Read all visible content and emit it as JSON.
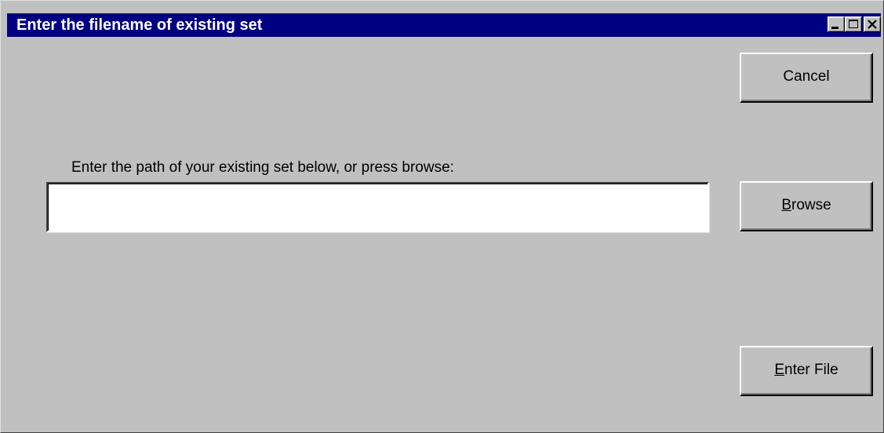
{
  "window": {
    "title": "Enter the filename of existing set",
    "controls": {
      "minimize_icon": "minimize-icon",
      "maximize_icon": "maximize-icon",
      "close_icon": "close-icon"
    },
    "title_bar_color": "#000080",
    "face_color": "#c0c0c0"
  },
  "form": {
    "prompt": "Enter the path of your existing set below, or press browse:",
    "path_value": "",
    "path_placeholder": ""
  },
  "buttons": {
    "cancel": {
      "label": "Cancel",
      "mnemonic": ""
    },
    "browse": {
      "mnemonic": "B",
      "rest": "rowse"
    },
    "enter_file": {
      "mnemonic": "E",
      "rest": "nter File"
    }
  }
}
